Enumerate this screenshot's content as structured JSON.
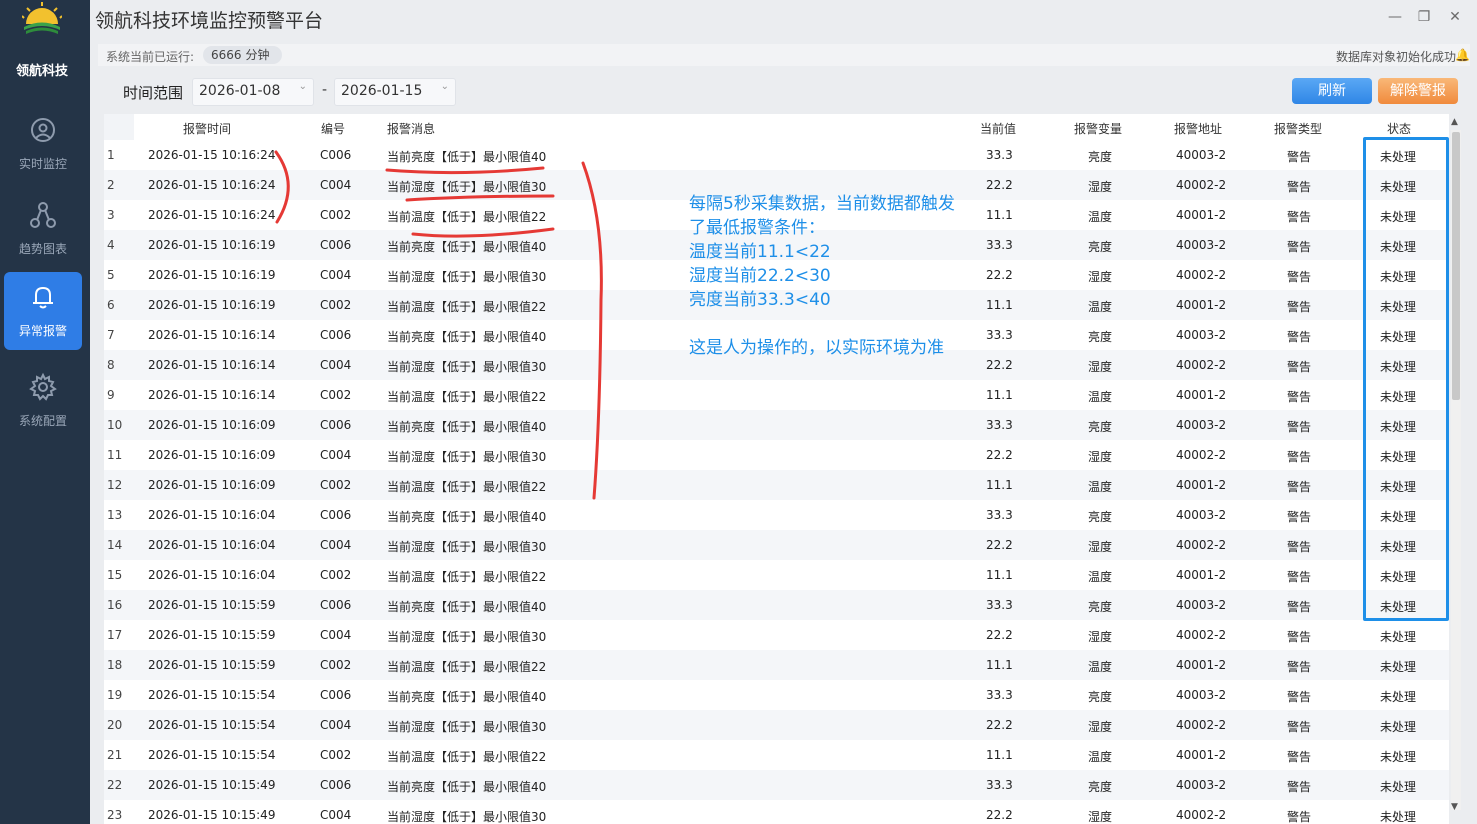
{
  "app": {
    "brand": "领航科技",
    "title": "领航科技环境监控预警平台"
  },
  "window_controls": {
    "minimize": "—",
    "restore": "❐",
    "close": "✕"
  },
  "sidebar": {
    "items": [
      {
        "label": "实时监控",
        "icon": "monitor-icon",
        "active": false
      },
      {
        "label": "趋势图表",
        "icon": "graph-icon",
        "active": false
      },
      {
        "label": "异常报警",
        "icon": "bell-icon",
        "active": true
      },
      {
        "label": "系统配置",
        "icon": "gear-icon",
        "active": false
      }
    ]
  },
  "status": {
    "uptime_label": "系统当前已运行:",
    "uptime_value": "6666",
    "uptime_unit": "分钟",
    "db_message": "数据库对象初始化成功"
  },
  "filter": {
    "range_label": "时间范围",
    "start_date": "2026-01-08",
    "end_date": "2026-01-15",
    "separator": "-",
    "refresh_label": "刷新",
    "clear_label": "解除警报"
  },
  "table": {
    "headers": [
      "报警时间",
      "编号",
      "报警消息",
      "当前值",
      "报警变量",
      "报警地址",
      "报警类型",
      "状态"
    ],
    "rows": [
      [
        "1",
        "2026-01-15 10:16:24",
        "C006",
        "当前亮度【低于】最小限值40",
        "33.3",
        "亮度",
        "40003-2",
        "警告",
        "未处理"
      ],
      [
        "2",
        "2026-01-15 10:16:24",
        "C004",
        "当前湿度【低于】最小限值30",
        "22.2",
        "湿度",
        "40002-2",
        "警告",
        "未处理"
      ],
      [
        "3",
        "2026-01-15 10:16:24",
        "C002",
        "当前温度【低于】最小限值22",
        "11.1",
        "温度",
        "40001-2",
        "警告",
        "未处理"
      ],
      [
        "4",
        "2026-01-15 10:16:19",
        "C006",
        "当前亮度【低于】最小限值40",
        "33.3",
        "亮度",
        "40003-2",
        "警告",
        "未处理"
      ],
      [
        "5",
        "2026-01-15 10:16:19",
        "C004",
        "当前湿度【低于】最小限值30",
        "22.2",
        "湿度",
        "40002-2",
        "警告",
        "未处理"
      ],
      [
        "6",
        "2026-01-15 10:16:19",
        "C002",
        "当前温度【低于】最小限值22",
        "11.1",
        "温度",
        "40001-2",
        "警告",
        "未处理"
      ],
      [
        "7",
        "2026-01-15 10:16:14",
        "C006",
        "当前亮度【低于】最小限值40",
        "33.3",
        "亮度",
        "40003-2",
        "警告",
        "未处理"
      ],
      [
        "8",
        "2026-01-15 10:16:14",
        "C004",
        "当前湿度【低于】最小限值30",
        "22.2",
        "湿度",
        "40002-2",
        "警告",
        "未处理"
      ],
      [
        "9",
        "2026-01-15 10:16:14",
        "C002",
        "当前温度【低于】最小限值22",
        "11.1",
        "温度",
        "40001-2",
        "警告",
        "未处理"
      ],
      [
        "10",
        "2026-01-15 10:16:09",
        "C006",
        "当前亮度【低于】最小限值40",
        "33.3",
        "亮度",
        "40003-2",
        "警告",
        "未处理"
      ],
      [
        "11",
        "2026-01-15 10:16:09",
        "C004",
        "当前湿度【低于】最小限值30",
        "22.2",
        "湿度",
        "40002-2",
        "警告",
        "未处理"
      ],
      [
        "12",
        "2026-01-15 10:16:09",
        "C002",
        "当前温度【低于】最小限值22",
        "11.1",
        "温度",
        "40001-2",
        "警告",
        "未处理"
      ],
      [
        "13",
        "2026-01-15 10:16:04",
        "C006",
        "当前亮度【低于】最小限值40",
        "33.3",
        "亮度",
        "40003-2",
        "警告",
        "未处理"
      ],
      [
        "14",
        "2026-01-15 10:16:04",
        "C004",
        "当前湿度【低于】最小限值30",
        "22.2",
        "湿度",
        "40002-2",
        "警告",
        "未处理"
      ],
      [
        "15",
        "2026-01-15 10:16:04",
        "C002",
        "当前温度【低于】最小限值22",
        "11.1",
        "温度",
        "40001-2",
        "警告",
        "未处理"
      ],
      [
        "16",
        "2026-01-15 10:15:59",
        "C006",
        "当前亮度【低于】最小限值40",
        "33.3",
        "亮度",
        "40003-2",
        "警告",
        "未处理"
      ],
      [
        "17",
        "2026-01-15 10:15:59",
        "C004",
        "当前湿度【低于】最小限值30",
        "22.2",
        "湿度",
        "40002-2",
        "警告",
        "未处理"
      ],
      [
        "18",
        "2026-01-15 10:15:59",
        "C002",
        "当前温度【低于】最小限值22",
        "11.1",
        "温度",
        "40001-2",
        "警告",
        "未处理"
      ],
      [
        "19",
        "2026-01-15 10:15:54",
        "C006",
        "当前亮度【低于】最小限值40",
        "33.3",
        "亮度",
        "40003-2",
        "警告",
        "未处理"
      ],
      [
        "20",
        "2026-01-15 10:15:54",
        "C004",
        "当前湿度【低于】最小限值30",
        "22.2",
        "湿度",
        "40002-2",
        "警告",
        "未处理"
      ],
      [
        "21",
        "2026-01-15 10:15:54",
        "C002",
        "当前温度【低于】最小限值22",
        "11.1",
        "温度",
        "40001-2",
        "警告",
        "未处理"
      ],
      [
        "22",
        "2026-01-15 10:15:49",
        "C006",
        "当前亮度【低于】最小限值40",
        "33.3",
        "亮度",
        "40003-2",
        "警告",
        "未处理"
      ],
      [
        "23",
        "2026-01-15 10:15:49",
        "C004",
        "当前湿度【低于】最小限值30",
        "22.2",
        "湿度",
        "40002-2",
        "警告",
        "未处理"
      ]
    ]
  },
  "annotation": {
    "lines": [
      "每隔5秒采集数据，当前数据都触发",
      "了最低报警条件：",
      "温度当前11.1<22",
      "湿度当前22.2<30",
      "亮度当前33.3<40"
    ],
    "note": "这是人为操作的，以实际环境为准",
    "color": "#1e8fe8",
    "scribble_color": "#e53935"
  },
  "colors": {
    "sidebar": "#243447",
    "active_nav": "#2f7de6",
    "refresh": "#3b8fe9",
    "clear": "#f4a05a"
  }
}
